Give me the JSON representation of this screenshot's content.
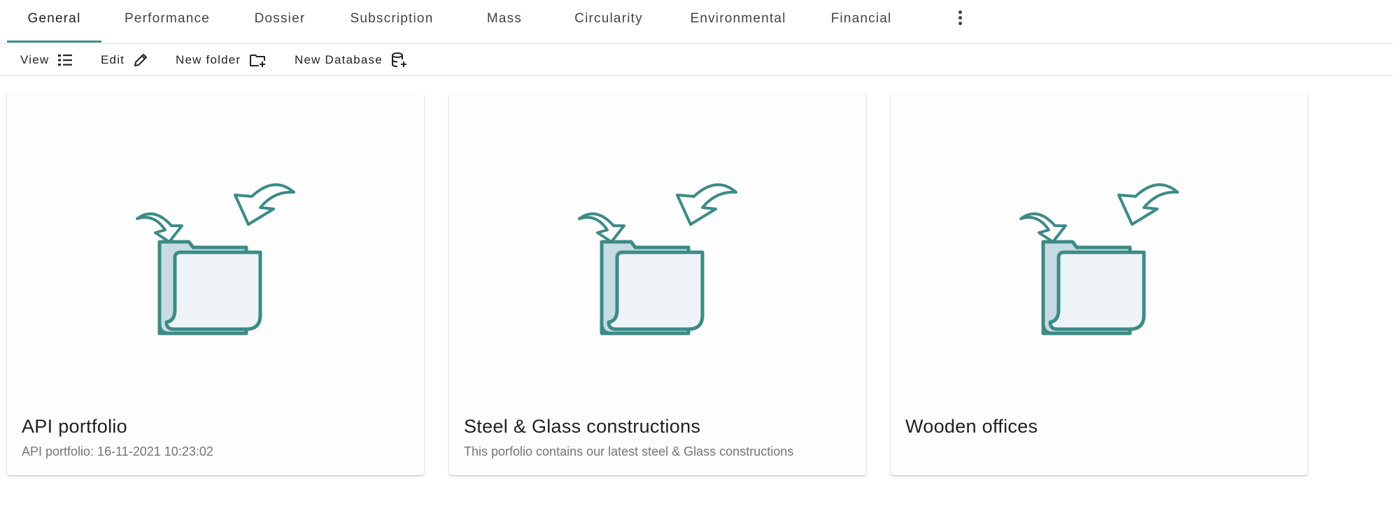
{
  "tabs": [
    {
      "label": "General",
      "active": true
    },
    {
      "label": "Performance"
    },
    {
      "label": "Dossier"
    },
    {
      "label": "Subscription"
    },
    {
      "label": "Mass"
    },
    {
      "label": "Circularity"
    },
    {
      "label": "Environmental"
    },
    {
      "label": "Financial"
    }
  ],
  "more_icon": "more-vertical-icon",
  "toolbar": {
    "view": {
      "label": "View",
      "icon": "list-icon"
    },
    "edit": {
      "label": "Edit",
      "icon": "pencil-icon"
    },
    "new_folder": {
      "label": "New folder",
      "icon": "folder-plus-icon"
    },
    "new_database": {
      "label": "New Database",
      "icon": "database-plus-icon"
    }
  },
  "cards": [
    {
      "title": "API portfolio",
      "subtitle": "API portfolio: 16-11-2021 10:23:02",
      "icon": "folder-illustration-icon"
    },
    {
      "title": "Steel & Glass constructions",
      "subtitle": "This porfolio contains our latest steel & Glass constructions",
      "icon": "folder-illustration-icon"
    },
    {
      "title": "Wooden offices",
      "subtitle": "",
      "icon": "folder-illustration-icon"
    }
  ],
  "colors": {
    "accent": "#3d8a86",
    "folder_back": "#c7dbe3",
    "folder_front": "#edf3f6"
  }
}
